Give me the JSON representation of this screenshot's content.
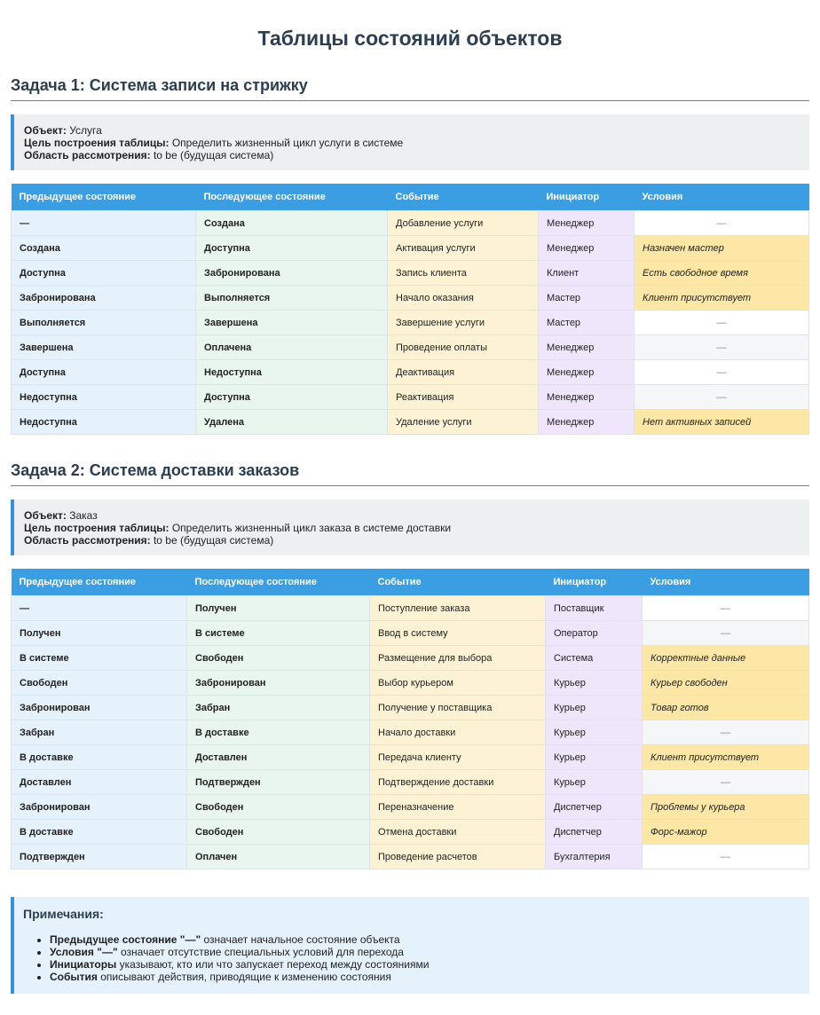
{
  "page_title": "Таблицы состояний объектов",
  "task1": {
    "heading": "Задача 1: Система записи на стрижку",
    "object_label": "Объект:",
    "object_value": "Услуга",
    "goal_label": "Цель построения таблицы:",
    "goal_value": "Определить жизненный цикл услуги в системе",
    "scope_label": "Область рассмотрения:",
    "scope_value": "to be (будущая система)",
    "headers": [
      "Предыдущее состояние",
      "Последующее состояние",
      "Событие",
      "Инициатор",
      "Условия"
    ],
    "rows": [
      {
        "prev": "—",
        "next": "Создана",
        "event": "Добавление услуги",
        "initiator": "Менеджер",
        "condition": "—"
      },
      {
        "prev": "Создана",
        "next": "Доступна",
        "event": "Активация услуги",
        "initiator": "Менеджер",
        "condition": "Назначен мастер"
      },
      {
        "prev": "Доступна",
        "next": "Забронирована",
        "event": "Запись клиента",
        "initiator": "Клиент",
        "condition": "Есть свободное время"
      },
      {
        "prev": "Забронирована",
        "next": "Выполняется",
        "event": "Начало оказания",
        "initiator": "Мастер",
        "condition": "Клиент присутствует"
      },
      {
        "prev": "Выполняется",
        "next": "Завершена",
        "event": "Завершение услуги",
        "initiator": "Мастер",
        "condition": "—"
      },
      {
        "prev": "Завершена",
        "next": "Оплачена",
        "event": "Проведение оплаты",
        "initiator": "Менеджер",
        "condition": "—"
      },
      {
        "prev": "Доступна",
        "next": "Недоступна",
        "event": "Деактивация",
        "initiator": "Менеджер",
        "condition": "—"
      },
      {
        "prev": "Недоступна",
        "next": "Доступна",
        "event": "Реактивация",
        "initiator": "Менеджер",
        "condition": "—"
      },
      {
        "prev": "Недоступна",
        "next": "Удалена",
        "event": "Удаление услуги",
        "initiator": "Менеджер",
        "condition": "Нет активных записей"
      }
    ]
  },
  "task2": {
    "heading": "Задача 2: Система доставки заказов",
    "object_label": "Объект:",
    "object_value": "Заказ",
    "goal_label": "Цель построения таблицы:",
    "goal_value": "Определить жизненный цикл заказа в системе доставки",
    "scope_label": "Область рассмотрения:",
    "scope_value": "to be (будущая система)",
    "headers": [
      "Предыдущее состояние",
      "Последующее состояние",
      "Событие",
      "Инициатор",
      "Условия"
    ],
    "rows": [
      {
        "prev": "—",
        "next": "Получен",
        "event": "Поступление заказа",
        "initiator": "Поставщик",
        "condition": "—"
      },
      {
        "prev": "Получен",
        "next": "В системе",
        "event": "Ввод в систему",
        "initiator": "Оператор",
        "condition": "—"
      },
      {
        "prev": "В системе",
        "next": "Свободен",
        "event": "Размещение для выбора",
        "initiator": "Система",
        "condition": "Корректные данные"
      },
      {
        "prev": "Свободен",
        "next": "Забронирован",
        "event": "Выбор курьером",
        "initiator": "Курьер",
        "condition": "Курьер свободен"
      },
      {
        "prev": "Забронирован",
        "next": "Забран",
        "event": "Получение у поставщика",
        "initiator": "Курьер",
        "condition": "Товар готов"
      },
      {
        "prev": "Забран",
        "next": "В доставке",
        "event": "Начало доставки",
        "initiator": "Курьер",
        "condition": "—"
      },
      {
        "prev": "В доставке",
        "next": "Доставлен",
        "event": "Передача клиенту",
        "initiator": "Курьер",
        "condition": "Клиент присутствует"
      },
      {
        "prev": "Доставлен",
        "next": "Подтвержден",
        "event": "Подтверждение доставки",
        "initiator": "Курьер",
        "condition": "—"
      },
      {
        "prev": "Забронирован",
        "next": "Свободен",
        "event": "Переназначение",
        "initiator": "Диспетчер",
        "condition": "Проблемы у курьера"
      },
      {
        "prev": "В доставке",
        "next": "Свободен",
        "event": "Отмена доставки",
        "initiator": "Диспетчер",
        "condition": "Форс-мажор"
      },
      {
        "prev": "Подтвержден",
        "next": "Оплачен",
        "event": "Проведение расчетов",
        "initiator": "Бухгалтерия",
        "condition": "—"
      }
    ]
  },
  "notes": {
    "title": "Примечания:",
    "items": [
      {
        "bold": "Предыдущее состояние \"—\"",
        "text": " означает начальное состояние объекта"
      },
      {
        "bold": "Условия \"—\"",
        "text": " означает отсутствие специальных условий для перехода"
      },
      {
        "bold": "Инициаторы",
        "text": " указывают, кто или что запускает переход между состояниями"
      },
      {
        "bold": "События",
        "text": " описывают действия, приводящие к изменению состояния"
      }
    ]
  },
  "colors": {
    "header_bg": "#3b9ee2",
    "accent": "#3b8fd6",
    "title": "#2c3e50",
    "condition_bg": "#fce7a6"
  }
}
